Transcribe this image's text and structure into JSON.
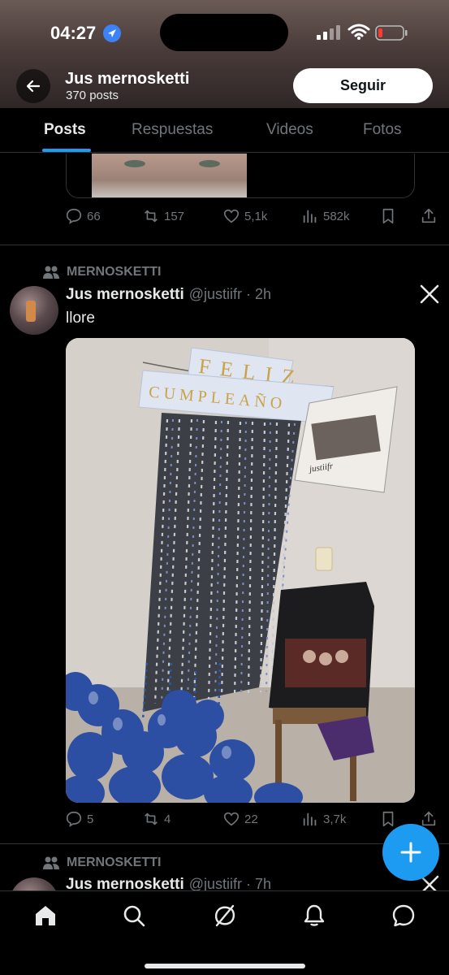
{
  "status_bar": {
    "time": "04:27"
  },
  "header": {
    "profile_name": "Jus mernosketti",
    "posts_count": "370 posts",
    "follow_label": "Seguir"
  },
  "tabs": [
    {
      "label": "Posts",
      "active": true
    },
    {
      "label": "Respuestas",
      "active": false
    },
    {
      "label": "Videos",
      "active": false
    },
    {
      "label": "Fotos",
      "active": false
    }
  ],
  "previous_post": {
    "replies": "66",
    "reposts": "157",
    "likes": "5,1k",
    "views": "582k"
  },
  "post": {
    "repost_label": "MERNOSKETTI",
    "author_name": "Jus mernosketti",
    "handle_time": "@justiifr · 2h",
    "text": "llore",
    "media_texts": {
      "banner_top": "FELIZ",
      "banner_bottom": "CUMPLEAÑO",
      "poster_signature": "justiifr"
    },
    "replies": "5",
    "reposts": "4",
    "likes": "22",
    "views": "3,7k"
  },
  "next_post": {
    "repost_label": "MERNOSKETTI",
    "author_name": "Jus mernosketti",
    "handle_time": "@justiifr · 7h"
  },
  "colors": {
    "accent": "#1d9bf0",
    "background": "#000000",
    "muted_text": "#71767b",
    "primary_text": "#e7e9ea"
  },
  "icons": [
    "location-arrow-icon",
    "signal-icon",
    "wifi-icon",
    "battery-low-icon",
    "back-arrow-icon",
    "reply-icon",
    "repost-icon",
    "like-icon",
    "views-icon",
    "bookmark-icon",
    "share-icon",
    "people-icon",
    "x-logo-icon",
    "plus-icon",
    "home-icon",
    "search-icon",
    "grok-icon",
    "bell-icon",
    "messages-icon"
  ]
}
